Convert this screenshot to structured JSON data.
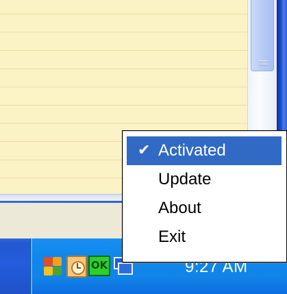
{
  "context_menu": {
    "items": [
      {
        "label": "Activated",
        "checked": true,
        "highlighted": true
      },
      {
        "label": "Update"
      },
      {
        "label": "About"
      },
      {
        "label": "Exit"
      }
    ],
    "check_glyph": "✔"
  },
  "tray": {
    "icons": [
      "office-icon",
      "clock-icon",
      "ok-icon",
      "network-icon"
    ],
    "ok_icon_text": "OK",
    "time": "9:27 AM"
  },
  "colors": {
    "menu_highlight": "#316ac5",
    "notepad_paper": "#fbf3c5",
    "taskbar_blue": "#245cdc",
    "tray_blue": "#0f88ec"
  }
}
